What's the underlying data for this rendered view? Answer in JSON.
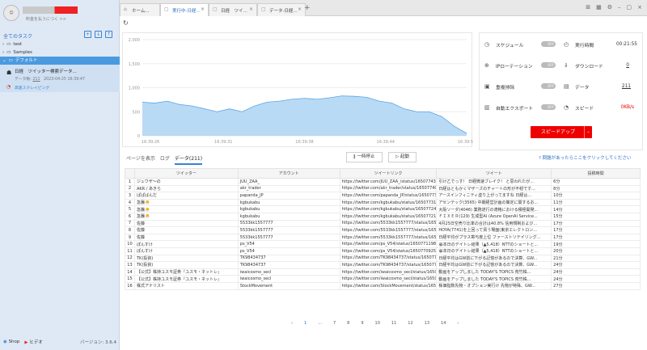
{
  "sidebar": {
    "notice": "料金を払うにつく >>",
    "all_tasks": "全てのタスク",
    "tree": [
      {
        "label": "test",
        "expanded": false
      },
      {
        "label": "Samples",
        "expanded": false
      },
      {
        "label": "デフォルト",
        "expanded": true
      }
    ],
    "task": {
      "title": "日経　ツイッター検索データ...",
      "data_label": "データ数",
      "data_count": "211",
      "date": "2023-04-25 16:39:47",
      "status": "高速スクレイピング"
    },
    "footer": {
      "shop": "Shop",
      "tutorial": "ヒデオ",
      "version": "バージョン: 3.6.4"
    }
  },
  "tabs": [
    {
      "label": "ホーム..."
    },
    {
      "label": "実行中-日経..."
    },
    {
      "label": "日経　ツイ..."
    },
    {
      "label": "データ-日経..."
    }
  ],
  "chart_data": {
    "type": "area",
    "title": "",
    "x_ticks": [
      "16:39:26",
      "16:39:31",
      "16:39:38",
      "16:39:44",
      "16:39:51"
    ],
    "y_ticks": [
      "2,000",
      "1,500",
      "1,000",
      "500",
      "0"
    ],
    "ylim": [
      0,
      2000
    ],
    "values": [
      700,
      680,
      720,
      650,
      620,
      560,
      500,
      560,
      500,
      620,
      700,
      720,
      760,
      780,
      760,
      790,
      830,
      820,
      800,
      720,
      680,
      560,
      500,
      500,
      400,
      200,
      50
    ]
  },
  "controls": {
    "schedule": "スケジュール",
    "schedule_state": "OFF",
    "run_time_label": "実行時間",
    "run_time": "00:21:55",
    "ip_rotation": "IPローテーション",
    "ip_state": "OFF",
    "download_label": "ダウンロード",
    "download_count": "0",
    "dedup": "重複排除",
    "dedup_state": "OFF",
    "data_label": "データ",
    "data_count": "211",
    "auto_export": "自動エクスポート",
    "export_state": "OFF",
    "speed_label": "スピード",
    "speed_value": "0KB/s",
    "speedup_button": "スピードアップ"
  },
  "subtabs": {
    "page": "ページを表示",
    "log": "ログ",
    "data": "データ(211)"
  },
  "actions": {
    "pause": "一時停止",
    "start": "起動",
    "help": "問題があったらここをクリックしてください"
  },
  "table": {
    "headers": [
      "",
      "ツイッター",
      "アカウント",
      "ツイートリンク",
      "ツイート",
      "投稿時間"
    ],
    "rows": [
      [
        "1",
        "ジュウザ〜の",
        "JUU_ZAA_",
        "https://twitter.com/JUU_ZAA_/status/165077437860...",
        "引け乙でっす！ 日経微速ブレイク！ と思われたが...",
        "6分"
      ],
      [
        "2",
        "AKR / あきら",
        "akr_trader",
        "https://twitter.com/akr_trader/status/16507740629...",
        "日経はともかくマザーズのチャートの形が不穏です...",
        "8分"
      ],
      [
        "3",
        "ぱぱばんだ",
        "papanda_JP",
        "https://twitter.com/papanda_JP/status/16507733823...",
        "アースインフィニティ虚り上がってますね 日経は...",
        "10分"
      ],
      [
        "4",
        "急騰🐣",
        "kgbukabu",
        "https://twitter.com/kgbukabu/status/16507731702...",
        "アセンテック(3565) 中期経営計画の策定に関するお...",
        "11分"
      ],
      [
        "5",
        "急騰🐣",
        "kgbukabu",
        "https://twitter.com/kgbukabu/status/165077246394...",
        "大阪ソーダ(4046) 業務遂行の適格における積極開発...",
        "14分"
      ],
      [
        "6",
        "急騰🐣",
        "kgbukabu",
        "https://twitter.com/kgbukabu/status/16507721973...",
        "ＦＩＸＥＲ(129) 生成型AI (Azure OpenAI Service...",
        "15分"
      ],
      [
        "7",
        "佐藤",
        "5533kk1557777",
        "https://twitter.com/5533kk1557777/status/1650...",
        "4月25日空売り比率の合計は40.8% 信用規制および...",
        "17分"
      ],
      [
        "8",
        "佐藤",
        "5533kk1557777",
        "https://twitter.com/5533kk1557777/status/1650...",
        "HOYA(7741)を上回って買う場面(東京エレクトロン...",
        "17分"
      ],
      [
        "9",
        "佐藤",
        "5533kk1557777",
        "https://twitter.com/5533kk1557777/status/1650...",
        "日経平均がプラス寄与度上位 ファーストリテイリング...",
        "17分"
      ],
      [
        "10",
        "ぽんすけ",
        "ps_V54",
        "https://twitter.com/ps_V54/status/16507711986873...",
        "😀本日のデイトレ結果（▲5,418）NTTのショートと...",
        "19分"
      ],
      [
        "11",
        "ぽんすけ",
        "ps_V54",
        "https://twitter.com/ps_V54/status/16507709253344...",
        "😀本日のデイトレ結果（▲5,418）NTTのショートと...",
        "20分"
      ],
      [
        "12",
        "TK(投資)",
        "TK98434737",
        "https://twitter.com/TK98434737/status/16507707...",
        "日経平均はGW前に下がる記憶があるので決算、GW...",
        "21分"
      ],
      [
        "13",
        "TK(投資)",
        "TK98434737",
        "https://twitter.com/TK98434737/status/16507707...",
        "日経平均はGW前に下がる記憶があるので決算、GW...",
        "24分"
      ],
      [
        "14",
        "【公式】株持ユスモ証券『ユスモ・ネットレ』",
        "iwaicosmo_secl",
        "https://twitter.com/iwaicosmo_secl/status/16507...",
        "動画をアップしました TODAY'S TOPICS 荒竹株...",
        "24分"
      ],
      [
        "15",
        "【公式】株持ユスモ証券『ユスモ・ネットレ』",
        "iwaicosmo_secl",
        "https://twitter.com/iwaicosmo_secl/status/16507...",
        "動画をアップしました TODAY'S TOPICS 荒竹株...",
        "24分"
      ],
      [
        "16",
        "株式アナリスト",
        "StockMovement",
        "https://twitter.com/StockMovement/status/16507614...",
        "株価指数先物・オプション実行け 先物が特殊、GW...",
        "27分"
      ]
    ]
  },
  "pager": {
    "pages": [
      "‹",
      "1",
      "...",
      "7",
      "8",
      "9",
      "10",
      "11",
      "12",
      "13",
      "14",
      "›"
    ]
  }
}
